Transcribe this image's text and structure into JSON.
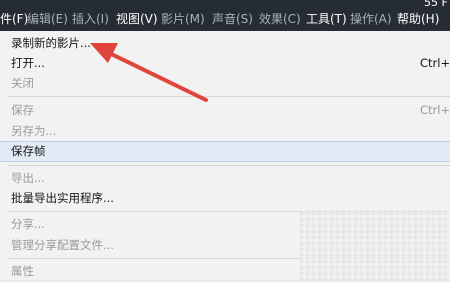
{
  "menubar": {
    "items": [
      {
        "label": "件(F)",
        "state": "normal"
      },
      {
        "label": "编辑(E)",
        "state": "dim"
      },
      {
        "label": "插入(I)",
        "state": "dim"
      },
      {
        "label": "视图(V)",
        "state": "normal"
      },
      {
        "label": "影片(M)",
        "state": "dim"
      },
      {
        "label": "声音(S)",
        "state": "dim"
      },
      {
        "label": "效果(C)",
        "state": "dim"
      },
      {
        "label": "工具(T)",
        "state": "normal"
      },
      {
        "label": "操作(A)",
        "state": "dim"
      },
      {
        "label": "帮助(H)",
        "state": "normal"
      }
    ],
    "title_fragment": "55 F"
  },
  "file_menu": {
    "items": [
      {
        "label": "录制新的影片...",
        "shortcut": "",
        "enabled": true
      },
      {
        "label": "打开...",
        "shortcut": "Ctrl+O",
        "enabled": true
      },
      {
        "label": "关闭",
        "shortcut": "",
        "enabled": false
      },
      {
        "label": "保存",
        "shortcut": "Ctrl+S",
        "enabled": false
      },
      {
        "label": "另存为...",
        "shortcut": "",
        "enabled": false
      },
      {
        "label": "保存帧",
        "shortcut": "",
        "enabled": true
      },
      {
        "label": "导出...",
        "shortcut": "",
        "enabled": false
      },
      {
        "label": "批量导出实用程序...",
        "shortcut": "",
        "enabled": true
      },
      {
        "label": "分享...",
        "shortcut": "",
        "enabled": false
      },
      {
        "label": "管理分享配置文件...",
        "shortcut": "",
        "enabled": false
      },
      {
        "label": "属性",
        "shortcut": "",
        "enabled": false
      }
    ]
  },
  "colors": {
    "menubar_bg": "#262c34",
    "highlight_bg": "#e2eaf6",
    "arrow_red": "#e0443a"
  },
  "annotation": {
    "icon": "red-arrow-icon"
  }
}
